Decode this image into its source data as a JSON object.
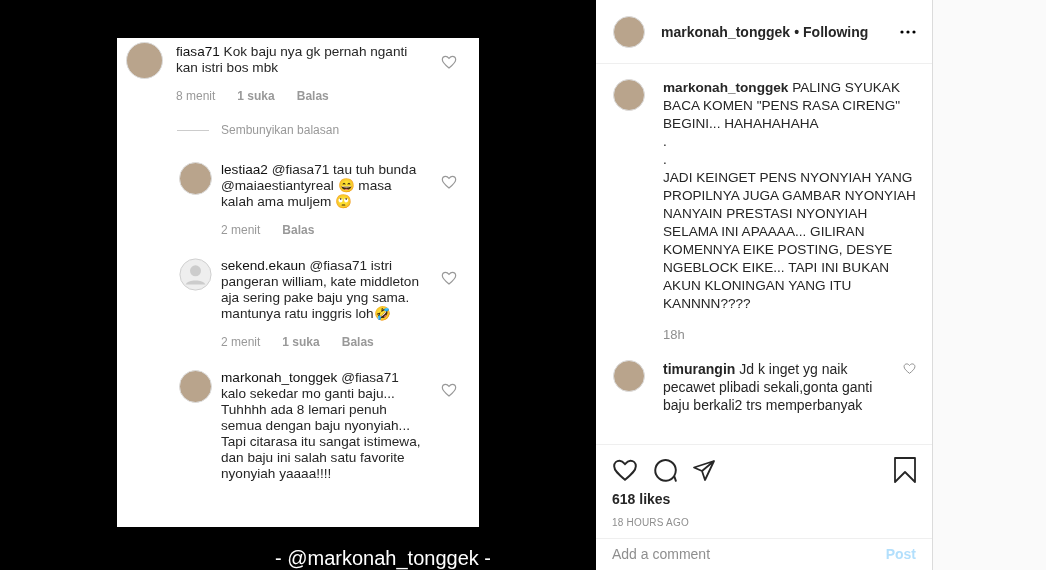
{
  "post_image": {
    "comments": [
      {
        "username": "fiasa71",
        "text": "Kok baju nya gk pernah nganti kan istri bos mbk",
        "time": "8 menit",
        "likes": "1 suka",
        "reply": "Balas",
        "hide_replies": "Sembunyikan balasan",
        "kind": "photo",
        "replies": [
          {
            "username": "lestiaa2",
            "text": "@fiasa71 tau tuh bunda @maiaestiantyreal 😄 masa kalah ama muljem 🙄",
            "time": "2 menit",
            "reply": "Balas",
            "kind": "photo"
          },
          {
            "username": "sekend.ekaun",
            "text": "@fiasa71 istri pangeran william, kate middleton aja sering pake baju yng sama. mantunya ratu inggris loh🤣",
            "time": "2 menit",
            "likes": "1 suka",
            "reply": "Balas",
            "kind": "default"
          },
          {
            "username": "markonah_tonggek",
            "text": "@fiasa71 kalo sekedar mo ganti baju... Tuhhhh ada 8 lemari penuh semua dengan baju nyonyiah... Tapi citarasa itu sangat istimewa, dan baju ini salah satu favorite nyonyiah yaaaa!!!!",
            "kind": "photo"
          }
        ]
      }
    ],
    "credit": "- @markonah_tonggek -"
  },
  "header": {
    "username": "markonah_tonggek",
    "separator": "•",
    "follow": "Following"
  },
  "caption": {
    "username": "markonah_tonggek",
    "text": "PALING SYUKAK BACA KOMEN \"PENS RASA CIRENG\" BEGINI... HAHAHAHAHA\n.\n.\nJADI KEINGET PENS NYONYIAH YANG PROPILNYA JUGA GAMBAR NYONYIAH NANYAIN PRESTASI NYONYIAH SELAMA INI APAAAA... GILIRAN KOMENNYA EIKE POSTING, DESYE NGEBLOCK EIKE... TAPI INI BUKAN AKUN KLONINGAN YANG ITU KANNNN????",
    "time": "18h"
  },
  "comments": [
    {
      "username": "timurangin",
      "text": "Jd k inget yg naik pecawet plibadi sekali,gonta ganti baju berkali2 trs memperbanyak"
    }
  ],
  "likes": "618 likes",
  "timestamp": "18 HOURS AGO",
  "comment_box": {
    "placeholder": "Add a comment",
    "post": "Post",
    "disabled": true
  }
}
